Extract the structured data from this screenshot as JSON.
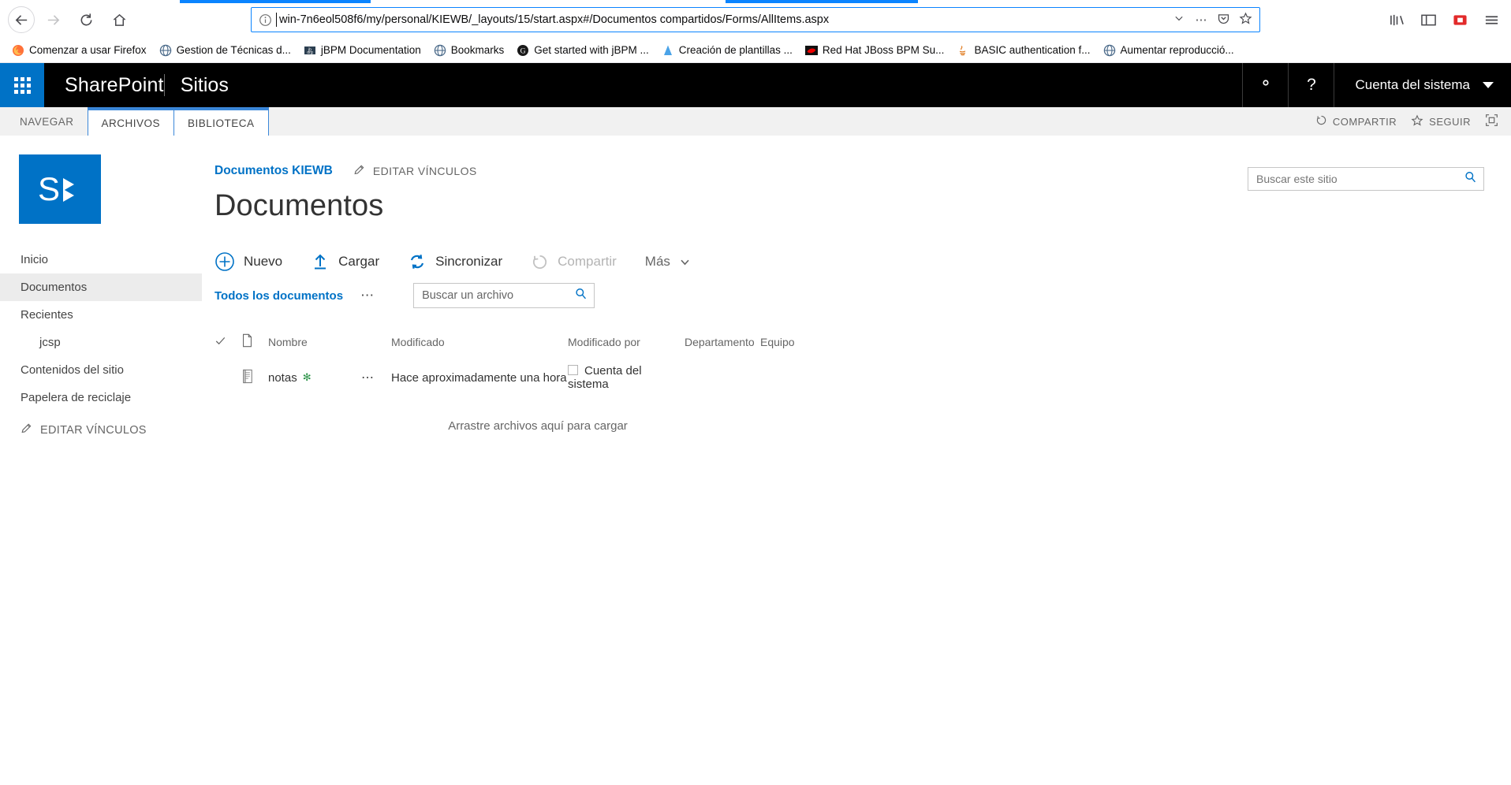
{
  "browser": {
    "url": "win-7n6eol508f6/my/personal/KIEWB/_layouts/15/start.aspx#/Documentos compartidos/Forms/AllItems.aspx",
    "nav": {
      "back_label": "←",
      "forward_label": "→",
      "reload_label": "⟳",
      "home_label": "⌂"
    },
    "urlbar": {
      "identity_icon": "info-icon",
      "dropdown_icon": "chevron-down-icon",
      "page_actions_icon": "ellipsis-icon",
      "pocket_icon": "pocket-icon",
      "bookmark_icon": "star-icon"
    },
    "toolbar_right": [
      {
        "name": "library-icon",
        "glyph": "library-icon"
      },
      {
        "name": "sidebar-icon",
        "glyph": "sidebar-icon"
      },
      {
        "name": "container-icon",
        "glyph": "container-icon"
      },
      {
        "name": "menu-icon",
        "glyph": "hamburger-icon"
      }
    ],
    "bookmarks": [
      {
        "label": "Comenzar a usar Firefox",
        "icon": "firefox-icon"
      },
      {
        "label": "Gestion de Técnicas d...",
        "icon": "globe-icon"
      },
      {
        "label": "jBPM Documentation",
        "icon": "jboss-icon"
      },
      {
        "label": "Bookmarks",
        "icon": "globe-icon"
      },
      {
        "label": "Get started with jBPM ...",
        "icon": "google-icon"
      },
      {
        "label": "Creación de plantillas ...",
        "icon": "drop-icon"
      },
      {
        "label": "Red Hat JBoss BPM Su...",
        "icon": "redhat-icon"
      },
      {
        "label": "BASIC authentication f...",
        "icon": "java-icon"
      },
      {
        "label": "Aumentar reproducció...",
        "icon": "globe-icon"
      }
    ]
  },
  "suitebar": {
    "app_launcher_icon": "waffle-icon",
    "brand": "SharePoint",
    "site": "Sitios",
    "settings_icon": "gear-icon",
    "help_icon": "help-icon",
    "user": "Cuenta del sistema",
    "user_caret_icon": "caret-down-icon"
  },
  "ribbon": {
    "tabs": [
      {
        "label": "NAVEGAR",
        "selected": false
      },
      {
        "label": "ARCHIVOS",
        "selected": true
      },
      {
        "label": "BIBLIOTECA",
        "selected": false
      }
    ],
    "share_label": "COMPARTIR",
    "share_icon": "share-icon",
    "follow_label": "SEGUIR",
    "follow_icon": "star-outline-icon",
    "focus_icon": "focus-on-content-icon"
  },
  "sidebar": {
    "logo_icon": "sharepoint-site-logo",
    "items": [
      {
        "label": "Inicio",
        "selected": false,
        "sub": false
      },
      {
        "label": "Documentos",
        "selected": true,
        "sub": false
      },
      {
        "label": "Recientes",
        "selected": false,
        "sub": false
      },
      {
        "label": "jcsp",
        "selected": false,
        "sub": true
      },
      {
        "label": "Contenidos del sitio",
        "selected": false,
        "sub": false
      },
      {
        "label": "Papelera de reciclaje",
        "selected": false,
        "sub": false
      }
    ],
    "edit_links_label": "EDITAR VÍNCULOS",
    "edit_links_icon": "pencil-icon"
  },
  "main": {
    "breadcrumb": "Documentos KIEWB",
    "edit_links_label": "EDITAR VÍNCULOS",
    "edit_links_icon": "pencil-icon",
    "title": "Documentos",
    "commands": [
      {
        "label": "Nuevo",
        "icon": "plus-circle-icon",
        "disabled": false
      },
      {
        "label": "Cargar",
        "icon": "upload-icon",
        "disabled": false
      },
      {
        "label": "Sincronizar",
        "icon": "sync-icon",
        "disabled": false
      },
      {
        "label": "Compartir",
        "icon": "share-icon",
        "disabled": true
      },
      {
        "label": "Más",
        "icon": "chevron-down-icon",
        "disabled": false
      }
    ],
    "view_name": "Todos los documentos",
    "view_more_icon": "ellipsis-icon",
    "file_search_placeholder": "Buscar un archivo",
    "file_search_icon": "search-icon",
    "columns": [
      {
        "key": "check",
        "label": "",
        "icon": "select-all-check-icon"
      },
      {
        "key": "type",
        "label": "",
        "icon": "document-type-icon"
      },
      {
        "key": "name",
        "label": "Nombre"
      },
      {
        "key": "dots",
        "label": ""
      },
      {
        "key": "modified",
        "label": "Modificado"
      },
      {
        "key": "modified_by",
        "label": "Modificado por"
      },
      {
        "key": "department",
        "label": "Departamento"
      },
      {
        "key": "team",
        "label": "Equipo"
      }
    ],
    "rows": [
      {
        "type_icon": "onenote-document-icon",
        "name": "notas",
        "new_badge": "✻",
        "row_menu_icon": "ellipsis-icon",
        "modified": "Hace aproximadamente una hora",
        "modified_by": "Cuenta del sistema",
        "department": "",
        "team": ""
      }
    ],
    "dropzone": "Arrastre archivos aquí para cargar",
    "site_search_placeholder": "Buscar este sitio",
    "site_search_icon": "search-icon"
  },
  "colors": {
    "accent": "#0072c6",
    "suitebar_bg": "#000000",
    "ribbon_bg": "#f1f1f1",
    "tab_border": "#3b87d9",
    "url_border": "#0a84ff",
    "new_badge": "#2b9348"
  }
}
